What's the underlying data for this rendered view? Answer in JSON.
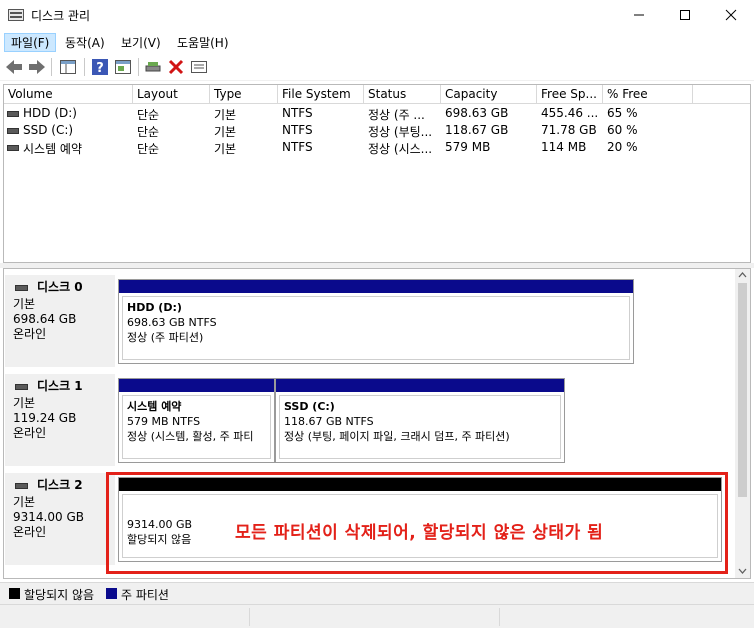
{
  "window": {
    "title": "디스크 관리"
  },
  "menu": [
    {
      "label": "파일(F)"
    },
    {
      "label": "동작(A)"
    },
    {
      "label": "보기(V)"
    },
    {
      "label": "도움말(H)"
    }
  ],
  "volume_list": {
    "columns": [
      "Volume",
      "Layout",
      "Type",
      "File System",
      "Status",
      "Capacity",
      "Free Sp...",
      "% Free"
    ],
    "rows": [
      {
        "volume": "HDD (D:)",
        "layout": "단순",
        "type": "기본",
        "fs": "NTFS",
        "status": "정상 (주 ...",
        "capacity": "698.63 GB",
        "free": "455.46 ...",
        "pct": "65 %"
      },
      {
        "volume": "SSD (C:)",
        "layout": "단순",
        "type": "기본",
        "fs": "NTFS",
        "status": "정상 (부팅...",
        "capacity": "118.67 GB",
        "free": "71.78 GB",
        "pct": "60 %"
      },
      {
        "volume": "시스템 예약",
        "layout": "단순",
        "type": "기본",
        "fs": "NTFS",
        "status": "정상 (시스...",
        "capacity": "579 MB",
        "free": "114 MB",
        "pct": "20 %"
      }
    ]
  },
  "disks": [
    {
      "name": "디스크 0",
      "type": "기본",
      "size": "698.64 GB",
      "state": "온라인",
      "partitions": [
        {
          "name": "HDD  (D:)",
          "size": "698.63 GB NTFS",
          "status": "정상 (주 파티션)"
        }
      ]
    },
    {
      "name": "디스크 1",
      "type": "기본",
      "size": "119.24 GB",
      "state": "온라인",
      "partitions": [
        {
          "name": "시스템 예약",
          "size": "579 MB NTFS",
          "status": "정상 (시스템, 활성, 주 파티"
        },
        {
          "name": "SSD  (C:)",
          "size": "118.67 GB NTFS",
          "status": "정상 (부팅, 페이지 파일, 크래시 덤프, 주 파티션)"
        }
      ]
    },
    {
      "name": "디스크 2",
      "type": "기본",
      "size": "9314.00 GB",
      "state": "온라인",
      "partitions": [
        {
          "size": "9314.00 GB",
          "status": "할당되지 않음"
        }
      ]
    }
  ],
  "annotation": {
    "text": "모든 파티션이 삭제되어, 할당되지 않은 상태가 됨",
    "color": "#e32119"
  },
  "legend": [
    {
      "label": "할당되지 않음",
      "color": "#000000"
    },
    {
      "label": "주 파티션",
      "color": "#0a0a8c"
    }
  ],
  "colors": {
    "primary_partition": "#0a0a8c",
    "unallocated": "#000000",
    "menu_highlight": "#cce8ff"
  }
}
